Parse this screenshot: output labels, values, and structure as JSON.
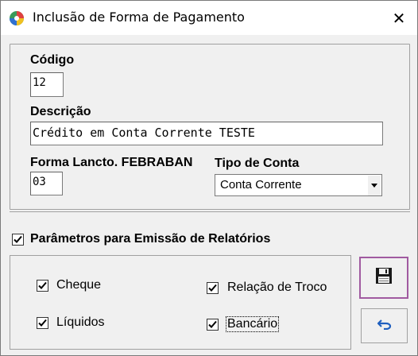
{
  "window": {
    "title": "Inclusão de Forma de Pagamento",
    "close_glyph": "✕"
  },
  "form": {
    "codigo": {
      "label": "Código",
      "value": "12"
    },
    "descricao": {
      "label": "Descrição",
      "value": "Crédito em Conta Corrente TESTE"
    },
    "forma_febraban": {
      "label": "Forma Lancto. FEBRABAN",
      "value": "03"
    },
    "tipo_conta": {
      "label": "Tipo de Conta",
      "selected": "Conta Corrente"
    }
  },
  "relatorios": {
    "label": "Parâmetros para Emissão de Relatórios",
    "checked": true,
    "options": [
      {
        "label": "Cheque",
        "checked": true
      },
      {
        "label": "Relação de Troco",
        "checked": true
      },
      {
        "label": "Líquidos",
        "checked": true
      },
      {
        "label": "Bancário",
        "checked": true
      }
    ]
  },
  "buttons": {
    "save_icon": "floppy-disk-icon",
    "undo_icon": "undo-arrow-icon"
  },
  "colors": {
    "window_bg": "#f0f0f0",
    "save_border": "#a05aa0",
    "undo_arrow": "#1f5fbf"
  }
}
